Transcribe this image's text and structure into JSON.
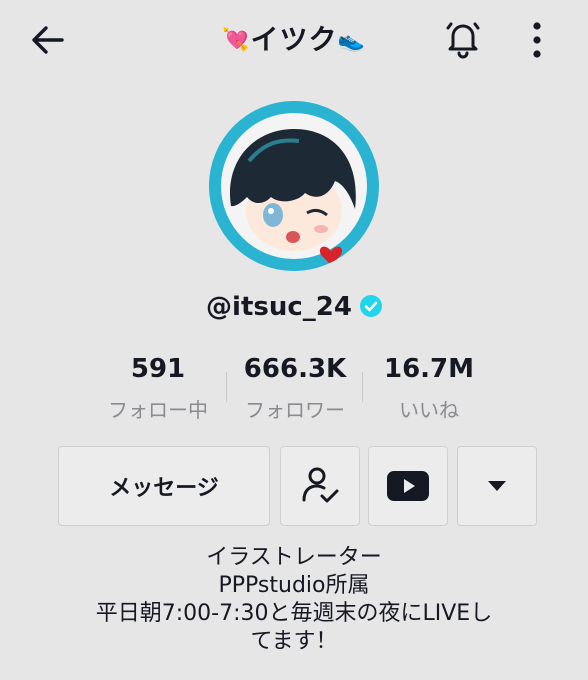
{
  "header": {
    "title": "イツク",
    "title_prefix_emoji": "💘",
    "title_suffix_emoji": "👟"
  },
  "profile": {
    "handle": "@itsuc_24",
    "verified": true,
    "accent_color": "#20d5ec"
  },
  "stats": [
    {
      "value": "591",
      "label": "フォロー中"
    },
    {
      "value": "666.3K",
      "label": "フォロワー"
    },
    {
      "value": "16.7M",
      "label": "いいね"
    }
  ],
  "actions": {
    "message_label": "メッセージ",
    "icons": [
      "person-check-icon",
      "youtube-icon",
      "triangle-down-icon"
    ]
  },
  "bio": [
    "イラストレーター",
    "PPPstudio所属",
    "平日朝7:00-7:30と毎週末の夜にLIVEし",
    "てます！"
  ]
}
